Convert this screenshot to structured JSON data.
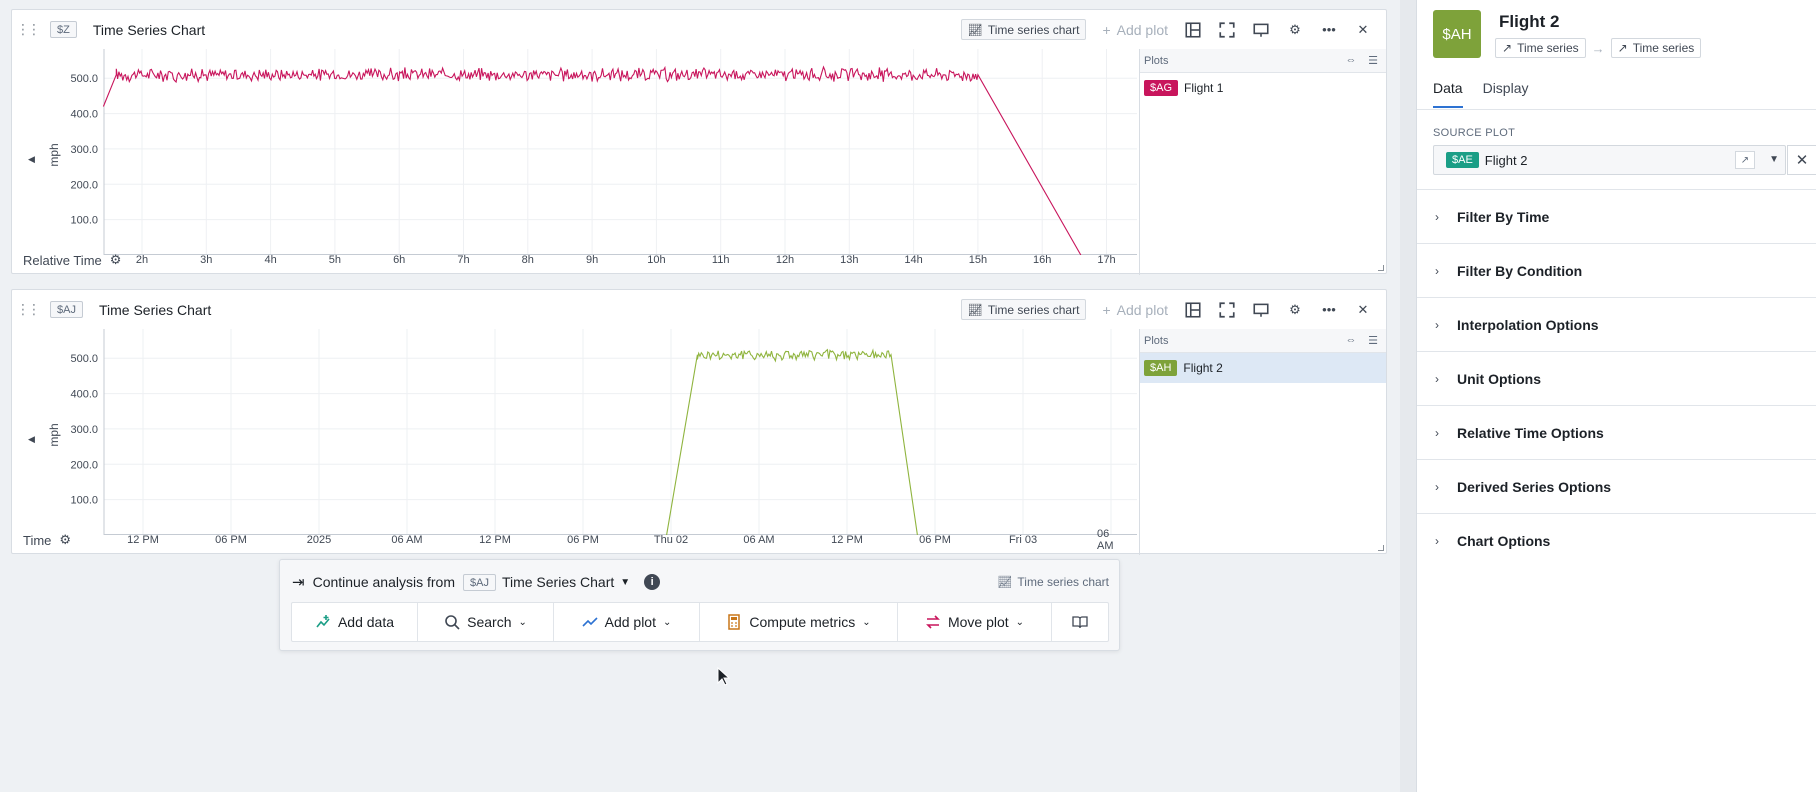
{
  "panels": [
    {
      "tag": "$Z",
      "title": "Time Series Chart",
      "type_label": "Time series chart",
      "add_plot_label": "Add plot",
      "plots_header": "Plots",
      "plots": [
        {
          "badge": "$AG",
          "name": "Flight 1",
          "color": "#c8155c"
        }
      ],
      "x_axis_label": "Relative Time",
      "y_unit": "mph"
    },
    {
      "tag": "$AJ",
      "title": "Time Series Chart",
      "type_label": "Time series chart",
      "add_plot_label": "Add plot",
      "plots_header": "Plots",
      "plots": [
        {
          "badge": "$AH",
          "name": "Flight 2",
          "color": "#7ea23a"
        }
      ],
      "x_axis_label": "Time",
      "y_unit": "mph"
    }
  ],
  "chart_data": [
    {
      "type": "line",
      "title": "",
      "xlabel": "Relative Time",
      "ylabel": "mph",
      "x_ticks": [
        "2h",
        "3h",
        "4h",
        "5h",
        "6h",
        "7h",
        "8h",
        "9h",
        "10h",
        "11h",
        "12h",
        "13h",
        "14h",
        "15h",
        "16h",
        "17h"
      ],
      "y_ticks": [
        100.0,
        200.0,
        300.0,
        400.0,
        500.0
      ],
      "ylim": [
        0,
        560
      ],
      "series": [
        {
          "name": "Flight 1",
          "color": "#c8155c",
          "points": [
            [
              1.4,
              420
            ],
            [
              1.6,
              510
            ],
            [
              15.0,
              510
            ],
            [
              16.6,
              0
            ]
          ],
          "noise_range": [
            1.6,
            15.0
          ],
          "noise_amplitude": 28
        }
      ]
    },
    {
      "type": "line",
      "title": "",
      "xlabel": "Time",
      "ylabel": "mph",
      "x_ticks": [
        "12 PM",
        "06 PM",
        "2025",
        "06 AM",
        "12 PM",
        "06 PM",
        "Thu 02",
        "06 AM",
        "12 PM",
        "06 PM",
        "Fri 03",
        "06 AM"
      ],
      "y_ticks": [
        100.0,
        200.0,
        300.0,
        400.0,
        500.0
      ],
      "ylim": [
        0,
        560
      ],
      "series": [
        {
          "name": "Flight 2",
          "color": "#8fb43e",
          "points": [
            [
              5.95,
              0
            ],
            [
              6.3,
              510
            ],
            [
              8.5,
              510
            ],
            [
              8.8,
              0
            ]
          ],
          "noise_range": [
            6.3,
            8.5
          ],
          "noise_amplitude": 25
        }
      ]
    }
  ],
  "continue_bar": {
    "label": "Continue analysis from",
    "tag": "$AJ",
    "chart_name": "Time Series Chart",
    "type_label": "Time series chart",
    "actions": [
      "Add data",
      "Search",
      "Add plot",
      "Compute metrics",
      "Move plot"
    ]
  },
  "sidebar": {
    "avatar": "$AH",
    "title": "Flight 2",
    "chip_from": "Time series",
    "chip_to": "Time series",
    "tabs": [
      "Data",
      "Display"
    ],
    "source_label": "SOURCE PLOT",
    "source_badge": "$AE",
    "source_name": "Flight 2",
    "sections": [
      "Filter By Time",
      "Filter By Condition",
      "Interpolation Options",
      "Unit Options",
      "Relative Time Options",
      "Derived Series Options",
      "Chart Options"
    ]
  }
}
